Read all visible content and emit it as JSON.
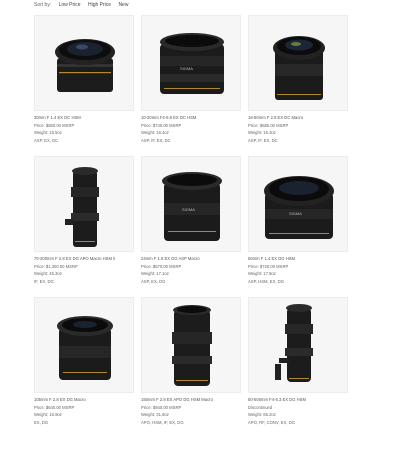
{
  "sort": {
    "label": "Sort by:",
    "options": [
      "Low Price",
      "High Price",
      "New"
    ]
  },
  "products": [
    {
      "name": "30mm F 1.4 EX DC HSM",
      "price": "Price: $650.00 MSRP",
      "weight": "Weight: 15.5oz",
      "features": "ASP, EX, DC",
      "icon": "standard-prime-lens-icon"
    },
    {
      "name": "10-20mm F4-5.6 EX DC HSM",
      "price": "Price: $740.00 MSRP",
      "weight": "Weight: 16.4oz",
      "features": "ASP, IF, EX, DC",
      "icon": "wide-zoom-lens-icon"
    },
    {
      "name": "18-50mm F 2.8 EX DC Macro",
      "price": "Price: $685.00 MSRP",
      "weight": "Weight: 15.3oz",
      "features": "ASP, IF, EX, DC",
      "icon": "standard-zoom-lens-icon"
    },
    {
      "name": "70-200mm F 2.8 EX DG APO Macro HSM II",
      "price": "Price: $1,300.00 MSRP",
      "weight": "Weight: 45.3oz",
      "features": "IF, EX, DG",
      "icon": "telephoto-zoom-lens-icon"
    },
    {
      "name": "24mm F 1.8 EX DG ASP Macro",
      "price": "Price: $570.00 MSRP",
      "weight": "Weight: 17.1oz",
      "features": "ASP, EX, DG",
      "icon": "wide-prime-lens-icon"
    },
    {
      "name": "50mm F 1.4 EX DG HSM",
      "price": "Price: $720.00 MSRP",
      "weight": "Weight: 17.8oz",
      "features": "ASP, HSM, EX, DG",
      "icon": "normal-prime-lens-icon"
    },
    {
      "name": "105mm F 2.8 EX DG Macro",
      "price": "Price: $640.00 MSRP",
      "weight": "Weight: 15.9oz",
      "features": "EX, DG",
      "icon": "macro-lens-icon"
    },
    {
      "name": "150mm F 2.8 EX APO DG HSM Macro",
      "price": "Price: $940.00 MSRP",
      "weight": "Weight: 31.8oz",
      "features": "APO, HSM, IF, EX, DG",
      "icon": "tele-macro-lens-icon"
    },
    {
      "name": "50-500mm F4-6.3 EX DG HSM",
      "price": "Discontinued",
      "weight": "Weight: 65.2oz",
      "features": "APO, RF, CONV, EX, DG",
      "icon": "super-telephoto-lens-icon"
    }
  ]
}
